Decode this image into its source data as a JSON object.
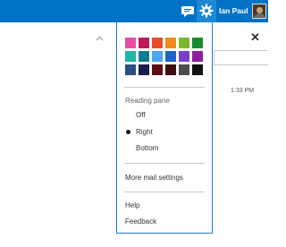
{
  "header": {
    "user_name": "Ian Paul",
    "chat_icon": "chat-icon",
    "settings_icon": "gear-icon",
    "accent": "#0072c6"
  },
  "background": {
    "close_glyph": "✕",
    "time": "1:33 PM"
  },
  "settings_menu": {
    "theme_colors": [
      [
        "#e74ea4",
        "#c0185a",
        "#e74b2b",
        "#f08c1e",
        "#7cb82f",
        "#178c2e"
      ],
      [
        "#21b3a6",
        "#0f7c95",
        "#4aa8f0",
        "#1e63c8",
        "#7b3fc8",
        "#8b1fa0"
      ],
      [
        "#2d4e80",
        "#171e4a",
        "#5e0f14",
        "#3b1010",
        "#4d4d4d",
        "#111111"
      ]
    ],
    "reading_pane": {
      "heading": "Reading pane",
      "options": [
        "Off",
        "Right",
        "Bottom"
      ],
      "selected": "Right"
    },
    "more_settings": "More mail settings",
    "help": "Help",
    "feedback": "Feedback"
  }
}
